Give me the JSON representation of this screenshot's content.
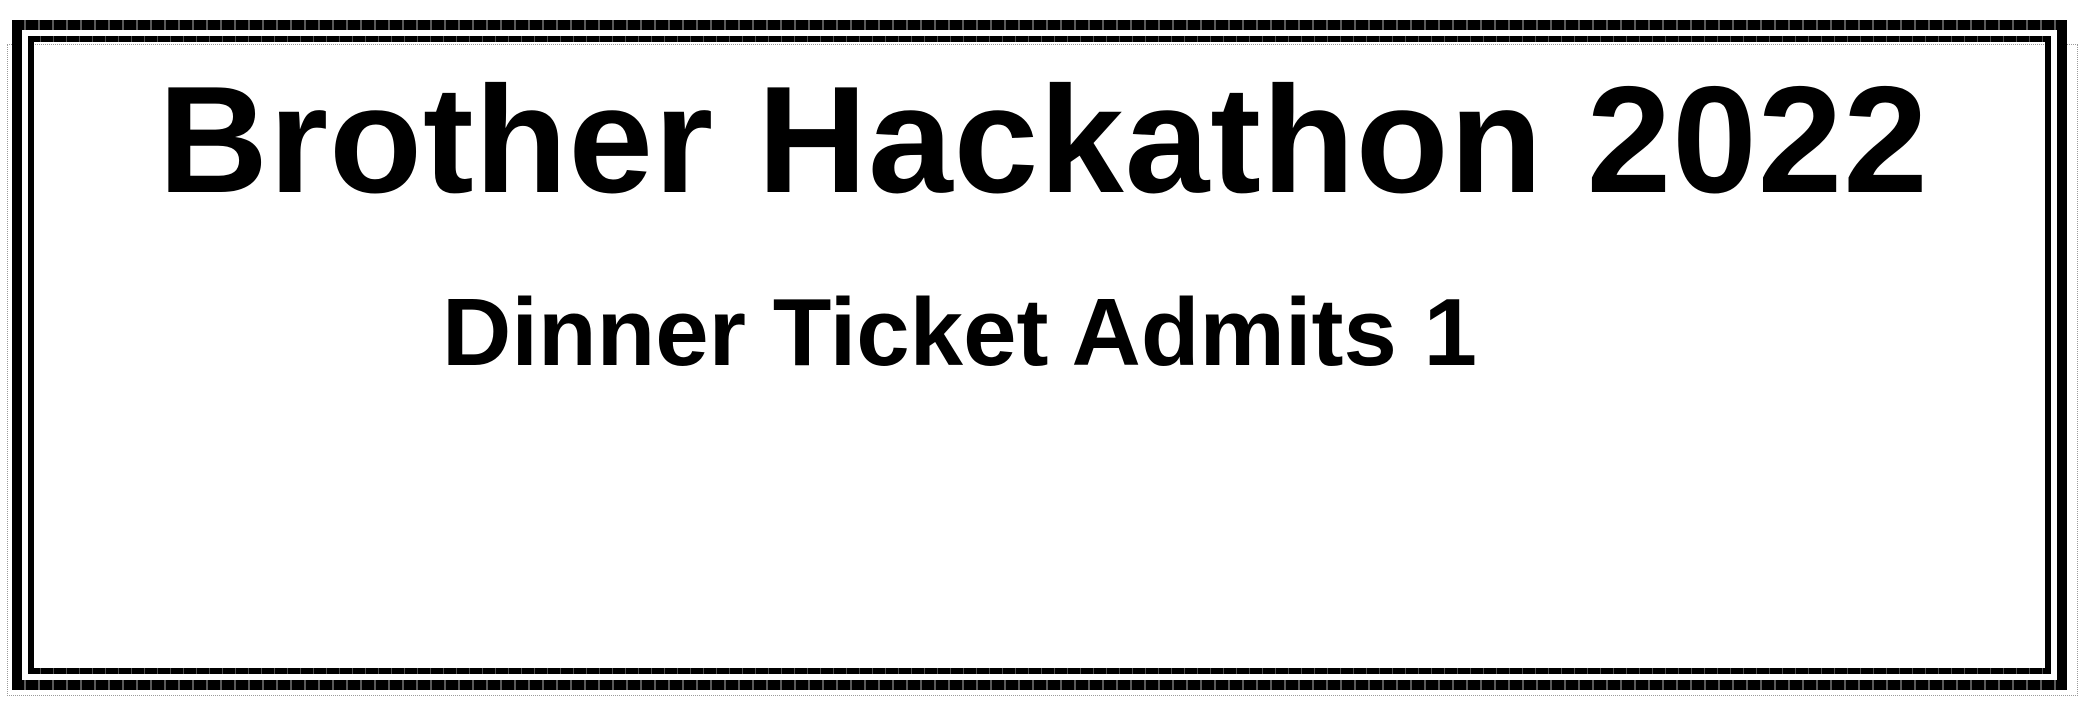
{
  "ticket": {
    "title": "Brother Hackathon 2022",
    "subtitle": "Dinner Ticket Admits 1"
  },
  "colors": {
    "text": "#000000",
    "border": "#000000",
    "background": "#ffffff"
  }
}
